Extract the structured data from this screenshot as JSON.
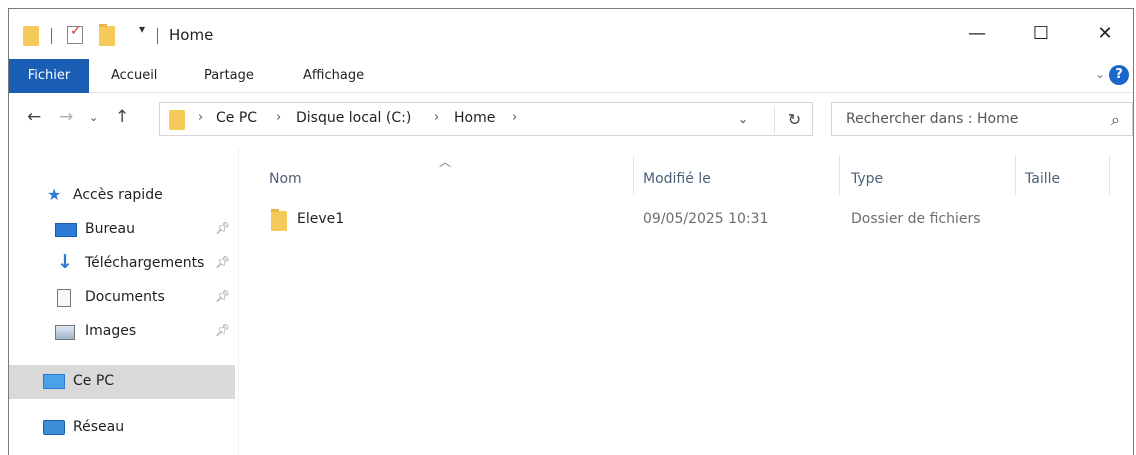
{
  "window": {
    "title": "Home",
    "controls": {
      "minimize": "—",
      "maximize": "☐",
      "close": "✕"
    }
  },
  "ribbon": {
    "tabs": [
      "Fichier",
      "Accueil",
      "Partage",
      "Affichage"
    ],
    "accent": "#1a5fb4"
  },
  "nav": {
    "breadcrumb": [
      "Ce PC",
      "Disque local (C:)",
      "Home"
    ],
    "search_placeholder": "Rechercher dans : Home"
  },
  "sidebar": {
    "items": [
      {
        "label": "Accès rapide",
        "icon": "star-icon",
        "pinned": false
      },
      {
        "label": "Bureau",
        "icon": "desktop-icon",
        "pinned": true
      },
      {
        "label": "Téléchargements",
        "icon": "download-icon",
        "pinned": true
      },
      {
        "label": "Documents",
        "icon": "documents-icon",
        "pinned": true
      },
      {
        "label": "Images",
        "icon": "images-icon",
        "pinned": true
      },
      {
        "label": "Ce PC",
        "icon": "computer-icon",
        "pinned": false,
        "selected": true
      },
      {
        "label": "Réseau",
        "icon": "network-icon",
        "pinned": false
      }
    ]
  },
  "files": {
    "columns": [
      "Nom",
      "Modifié le",
      "Type",
      "Taille"
    ],
    "rows": [
      {
        "name": "Eleve1",
        "modified": "09/05/2025 10:31",
        "type": "Dossier de fichiers",
        "size": ""
      }
    ]
  }
}
